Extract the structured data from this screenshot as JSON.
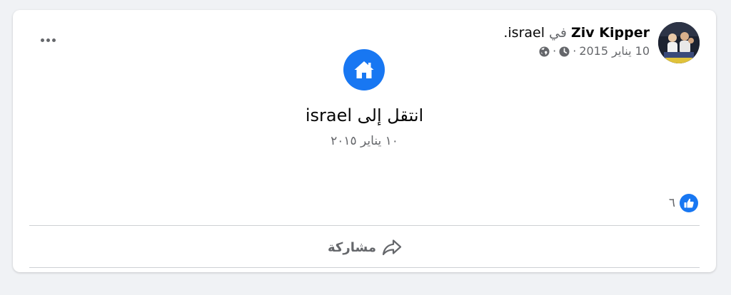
{
  "post": {
    "author": "Ziv Kipper",
    "in_text": "في",
    "place": "israel.",
    "date": "10 يناير 2015",
    "dot_separator": "·",
    "privacy_icon": "globe-icon",
    "more_icon": "more-horizontal-icon"
  },
  "life_event": {
    "icon": "home-icon",
    "title": "انتقل إلى israel",
    "date": "١٠ يناير ٢٠١٥"
  },
  "reactions": {
    "icon": "like-icon",
    "count": "٦"
  },
  "actions": {
    "share_label": "مشاركة",
    "share_icon": "share-arrow-icon"
  },
  "colors": {
    "accent": "#1877f2",
    "secondary_text": "#65676b",
    "primary_text": "#050505",
    "background": "#f0f2f5"
  }
}
